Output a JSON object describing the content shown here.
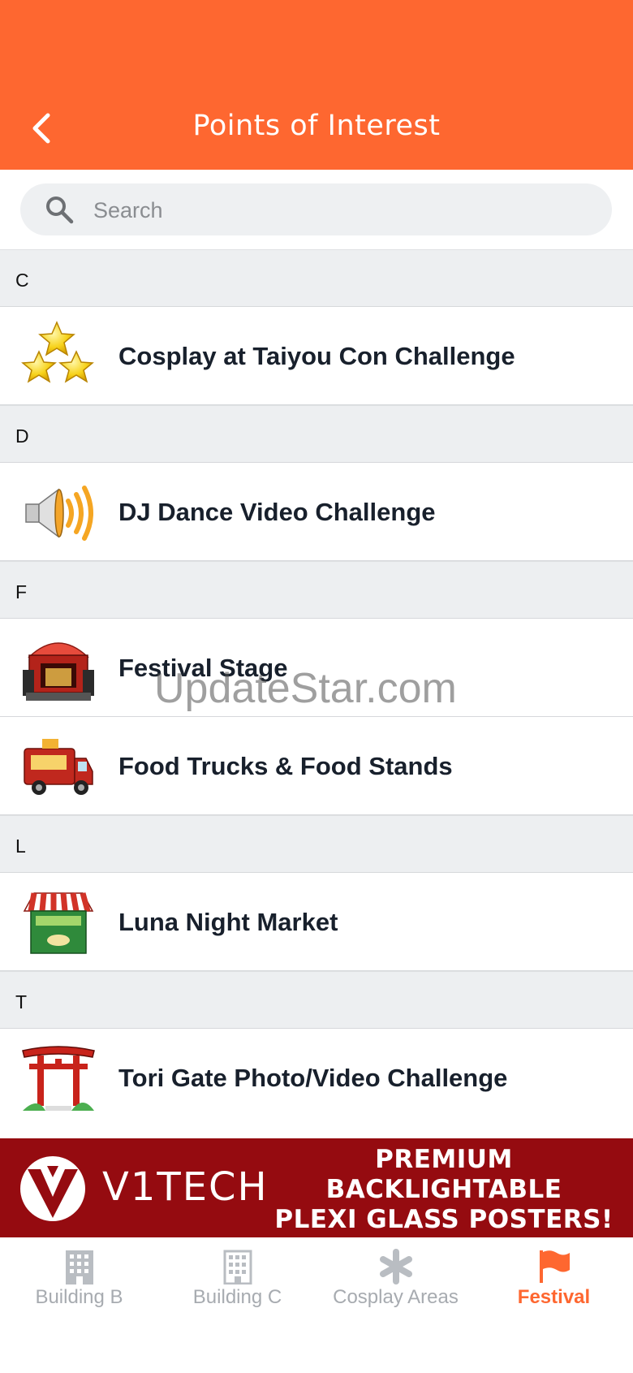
{
  "header": {
    "title": "Points of Interest",
    "back_icon": "chevron-left-icon",
    "bg_color": "#fe6730"
  },
  "search": {
    "placeholder": "Search",
    "value": ""
  },
  "sections": [
    {
      "letter": "C",
      "items": [
        {
          "label": "Cosplay at Taiyou Con Challenge",
          "icon": "stars-icon"
        }
      ]
    },
    {
      "letter": "D",
      "items": [
        {
          "label": "DJ Dance Video Challenge",
          "icon": "speaker-icon"
        }
      ]
    },
    {
      "letter": "F",
      "items": [
        {
          "label": "Festival Stage",
          "icon": "stage-icon"
        },
        {
          "label": "Food Trucks & Food Stands",
          "icon": "food-truck-icon"
        }
      ]
    },
    {
      "letter": "L",
      "items": [
        {
          "label": "Luna Night Market",
          "icon": "market-stall-icon"
        }
      ]
    },
    {
      "letter": "T",
      "items": [
        {
          "label": "Tori Gate Photo/Video Challenge",
          "icon": "torii-gate-icon"
        }
      ]
    }
  ],
  "watermark": "UpdateStar.com",
  "banner": {
    "brand": "V1TECH",
    "line1": "PREMIUM",
    "line2": "BACKLIGHTABLE",
    "line3": "PLEXI GLASS POSTERS!",
    "bg_color": "#950b10"
  },
  "tabs": [
    {
      "label": "Building B",
      "icon": "building-icon",
      "active": false
    },
    {
      "label": "Building C",
      "icon": "building-outline-icon",
      "active": false
    },
    {
      "label": "Cosplay Areas",
      "icon": "asterisk-icon",
      "active": false
    },
    {
      "label": "Festival",
      "icon": "flag-icon",
      "active": true
    }
  ],
  "colors": {
    "accent": "#fe6730",
    "inactive_tab": "#a7abb0",
    "section_bg": "#edeff1"
  }
}
